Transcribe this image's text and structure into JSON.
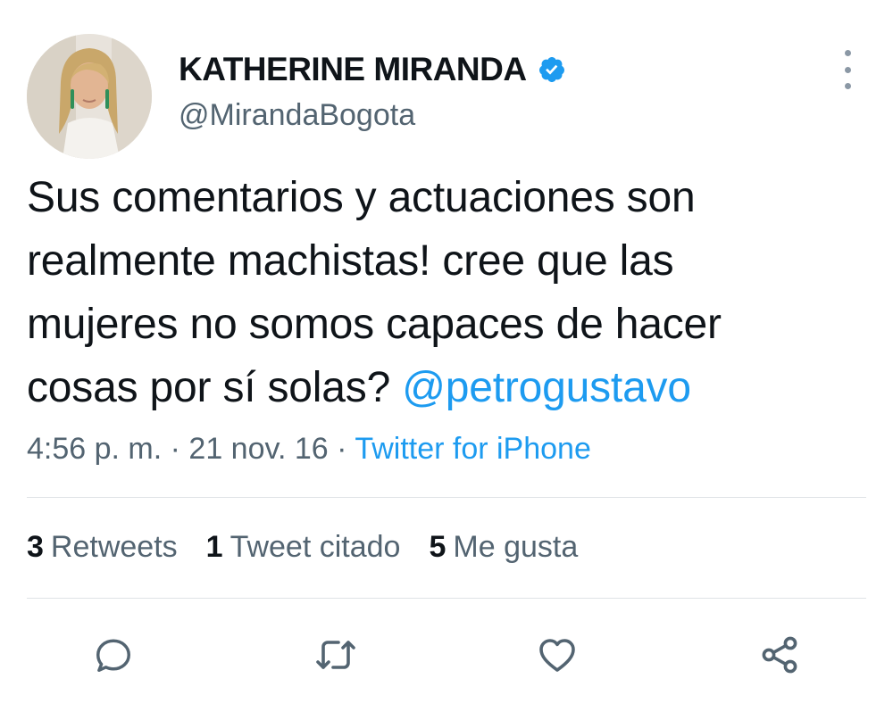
{
  "author": {
    "display_name": "KATHERINE MIRANDA",
    "handle": "@MirandaBogota",
    "verified_icon": "verified-badge-icon",
    "avatar": "profile-photo"
  },
  "tweet": {
    "lines": [
      "Sus comentarios y actuaciones son",
      "realmente machistas! cree que las",
      "mujeres no somos capaces de hacer",
      "cosas por sí solas? "
    ],
    "mention": "@petrogustavo",
    "time": "4:56 p. m.",
    "date": "21 nov. 16",
    "separator": " · ",
    "source": "Twitter for iPhone"
  },
  "stats": {
    "retweets_count": "3",
    "retweets_label": "Retweets",
    "quotes_count": "1",
    "quotes_label": "Tweet citado",
    "likes_count": "5",
    "likes_label": "Me gusta"
  },
  "actions": [
    "reply-icon",
    "retweet-icon",
    "like-icon",
    "share-icon"
  ],
  "colors": {
    "accent": "#1d9bf0",
    "secondary_text": "#536471",
    "primary_text": "#0f1419",
    "divider": "#dfe3e6"
  }
}
